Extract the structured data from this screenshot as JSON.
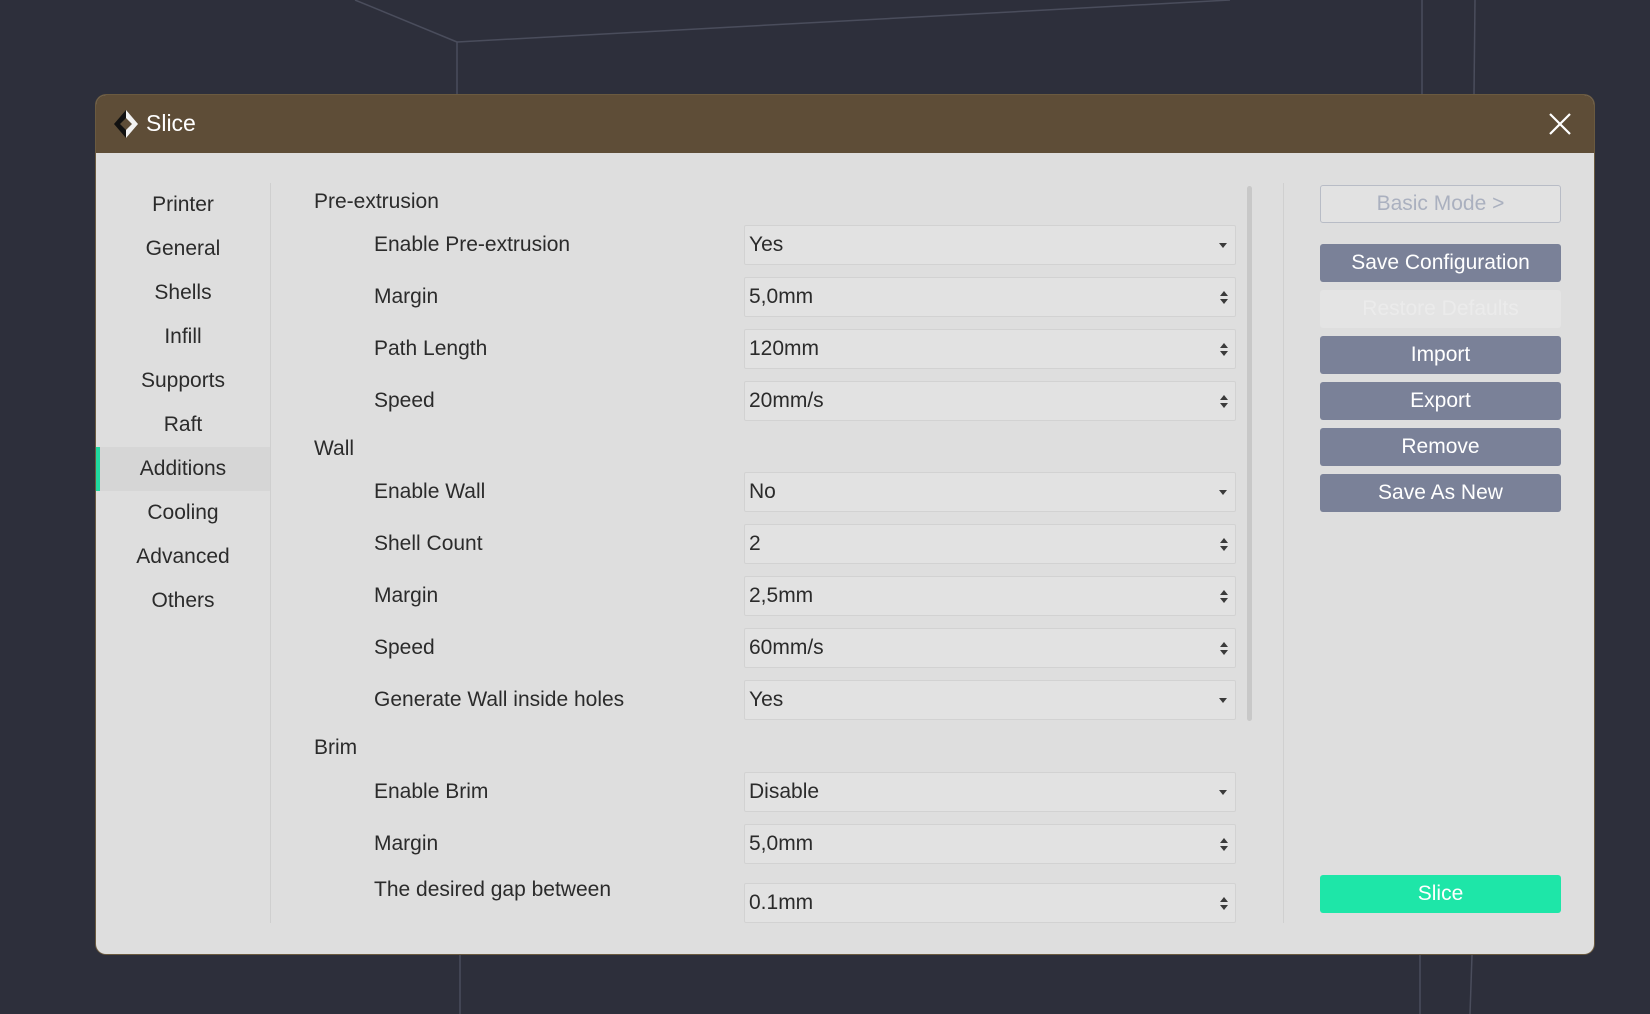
{
  "dialog": {
    "title": "Slice"
  },
  "sidebar": {
    "items": [
      {
        "label": "Printer"
      },
      {
        "label": "General"
      },
      {
        "label": "Shells"
      },
      {
        "label": "Infill"
      },
      {
        "label": "Supports"
      },
      {
        "label": "Raft"
      },
      {
        "label": "Additions",
        "active": true
      },
      {
        "label": "Cooling"
      },
      {
        "label": "Advanced"
      },
      {
        "label": "Others"
      }
    ]
  },
  "settings": {
    "pre_extrusion": {
      "title": "Pre-extrusion",
      "enable": {
        "label": "Enable Pre-extrusion",
        "value": "Yes"
      },
      "margin": {
        "label": "Margin",
        "value": "5,0mm"
      },
      "path_length": {
        "label": "Path Length",
        "value": "120mm"
      },
      "speed": {
        "label": "Speed",
        "value": "20mm/s"
      }
    },
    "wall": {
      "title": "Wall",
      "enable": {
        "label": "Enable Wall",
        "value": "No"
      },
      "shell_count": {
        "label": "Shell Count",
        "value": "2"
      },
      "margin": {
        "label": "Margin",
        "value": "2,5mm"
      },
      "speed": {
        "label": "Speed",
        "value": "60mm/s"
      },
      "inside_holes": {
        "label": "Generate Wall inside holes",
        "value": "Yes"
      }
    },
    "brim": {
      "title": "Brim",
      "enable": {
        "label": "Enable Brim",
        "value": "Disable"
      },
      "margin": {
        "label": "Margin",
        "value": "5,0mm"
      },
      "gap": {
        "label": "The desired gap between",
        "value": "0.1mm"
      }
    }
  },
  "actions": {
    "basic_mode": "Basic Mode >",
    "save_configuration": "Save Configuration",
    "restore_defaults": "Restore Defaults",
    "import": "Import",
    "export": "Export",
    "remove": "Remove",
    "save_as_new": "Save As New",
    "slice": "Slice"
  },
  "colors": {
    "titlebar": "#5e4d37",
    "accent": "#1ee6a8",
    "button": "#7a8198",
    "background": "#2d2f3b"
  }
}
